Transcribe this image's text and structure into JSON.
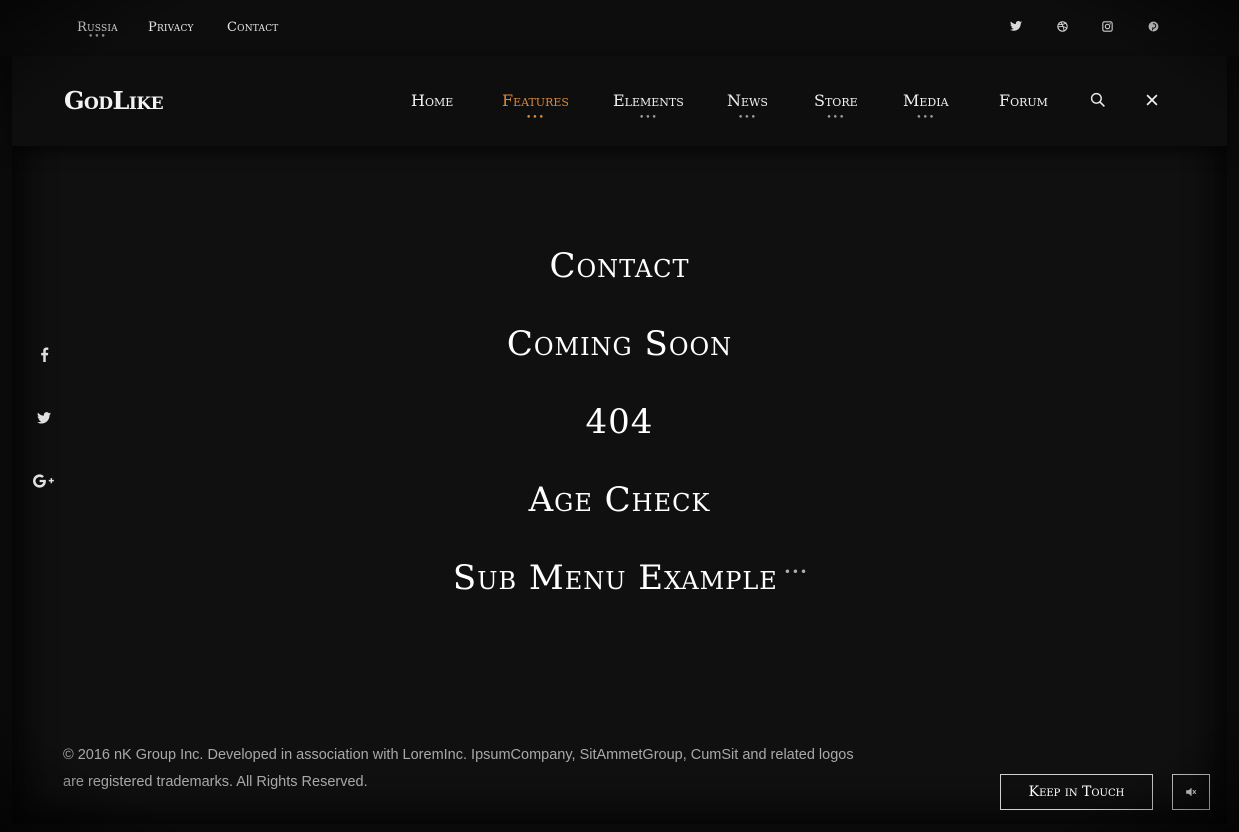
{
  "topbar": {
    "links": [
      {
        "label": "Russia"
      },
      {
        "label": "Privacy"
      },
      {
        "label": "Contact"
      }
    ],
    "social": [
      "twitter-icon",
      "dribbble-icon",
      "instagram-icon",
      "pinterest-icon"
    ]
  },
  "brand": {
    "logo": "GodLike"
  },
  "nav": {
    "items": [
      {
        "label": "Home"
      },
      {
        "label": "Features"
      },
      {
        "label": "Elements"
      },
      {
        "label": "News"
      },
      {
        "label": "Store"
      },
      {
        "label": "Media"
      },
      {
        "label": "Forum"
      }
    ],
    "active": "Features",
    "icons": [
      "search-icon",
      "close-icon"
    ]
  },
  "side_social": [
    "facebook-icon",
    "twitter-icon",
    "google-plus-icon"
  ],
  "menu": {
    "items": [
      {
        "label": "Contact"
      },
      {
        "label": "Coming Soon"
      },
      {
        "label": "404"
      },
      {
        "label": "Age Check"
      },
      {
        "label": "Sub Menu Example"
      }
    ]
  },
  "footer": {
    "copyright": "© 2016 nK Group Inc. Developed in association with LoremInc. IpsumCompany, SitAmmetGroup, CumSit and related logos are registered trademarks. All Rights Reserved.",
    "keep_in_touch": "Keep in Touch"
  },
  "colors": {
    "accent": "#d9893a",
    "background": "#101010",
    "text": "#ffffff"
  }
}
